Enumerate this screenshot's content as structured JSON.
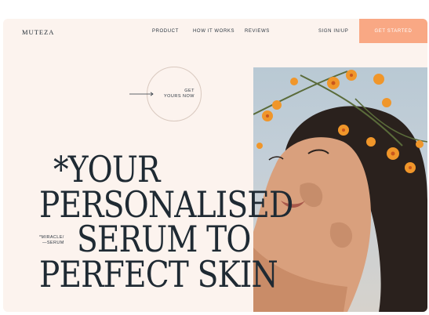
{
  "brand": {
    "logo": "MUTEZA"
  },
  "nav": {
    "items": [
      "PRODUCT",
      "HOW IT WORKS",
      "REVIEWS"
    ],
    "signin": "SIGN IN/UP",
    "cta": "GET STARTED"
  },
  "hero": {
    "circle_line1": "GET",
    "circle_line2": "YOURS NOW",
    "line1": "*YOUR",
    "line2": "PERSONALISED",
    "line3": "SERUM TO",
    "line4": "PERFECT SKIN",
    "note_line1": "*MIRACLE/",
    "note_line2": "—SERUM"
  },
  "colors": {
    "background": "#fcf3ee",
    "accent": "#f9a884",
    "text": "#1f2a33",
    "flower": "#f0962a"
  }
}
